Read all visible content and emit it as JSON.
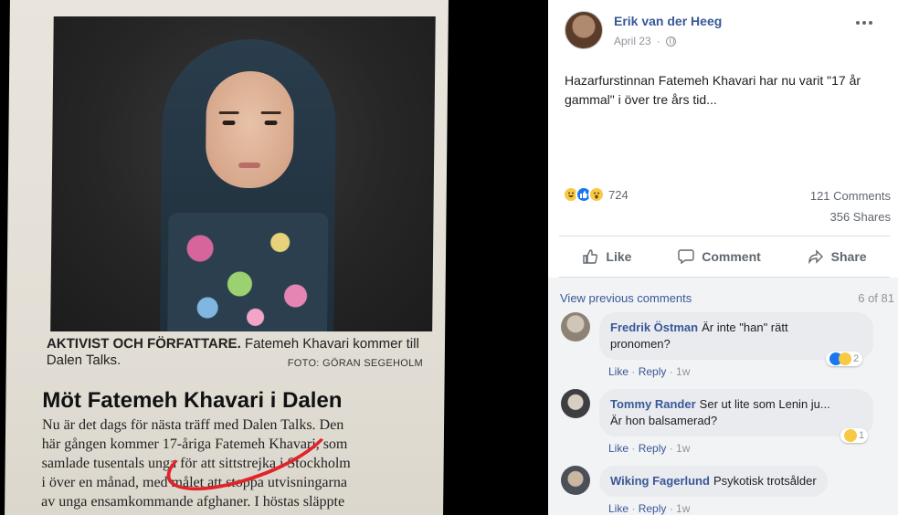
{
  "photo": {
    "caption_bold": "AKTIVIST OCH FÖRFATTARE.",
    "caption_rest": "Fatemeh Khavari kommer till Dalen Talks.",
    "credit": "FOTO: GÖRAN SEGEHOLM",
    "headline": "Möt Fatemeh Khavari i Dalen",
    "body_lines": [
      "Nu är det dags för nästa träff med Dalen Talks. Den",
      "här gången kommer 17-åriga Fatemeh Khavari, som",
      "samlade tusentals unga för att sittstrejka i Stockholm",
      "i över en månad, med målet att stoppa utvisningarna",
      "av unga ensamkommande afghaner. I höstas släppte"
    ]
  },
  "post": {
    "author": "Erik van der Heeg",
    "date": "April 23",
    "text": "Hazarfurstinnan Fatemeh Khavari har nu varit \"17 år gammal\" i över tre års tid...",
    "reaction_count": "724",
    "comments_count": "121 Comments",
    "shares_count": "356 Shares",
    "actions": {
      "like": "Like",
      "comment": "Comment",
      "share": "Share"
    }
  },
  "comments_section": {
    "view_previous": "View previous comments",
    "count_of": "6 of 81",
    "items": [
      {
        "name": "Fredrik Östman",
        "text_line1": "Är inte \"han\" rätt",
        "text_line2": "pronomen?",
        "reaction_count": "2",
        "like": "Like",
        "reply": "Reply",
        "time": "1w"
      },
      {
        "name": "Tommy Rander",
        "text_line1": "Ser ut lite som Lenin ju...",
        "text_line2": "Är hon balsamerad?",
        "reaction_count": "1",
        "like": "Like",
        "reply": "Reply",
        "time": "1w"
      },
      {
        "name": "Wiking Fagerlund",
        "text_line1": "Psykotisk trotsålder",
        "like": "Like",
        "reply": "Reply",
        "time": "1w"
      }
    ]
  },
  "colors": {
    "link_blue": "#385898",
    "like_blue": "#1877f2",
    "haha_yellow": "#f7c944",
    "marker_red": "#e2232a"
  },
  "icons": [
    "globe-icon",
    "more-icon",
    "like-icon",
    "comment-icon",
    "share-icon",
    "haha-reaction-icon",
    "like-reaction-icon",
    "wow-reaction-icon"
  ]
}
